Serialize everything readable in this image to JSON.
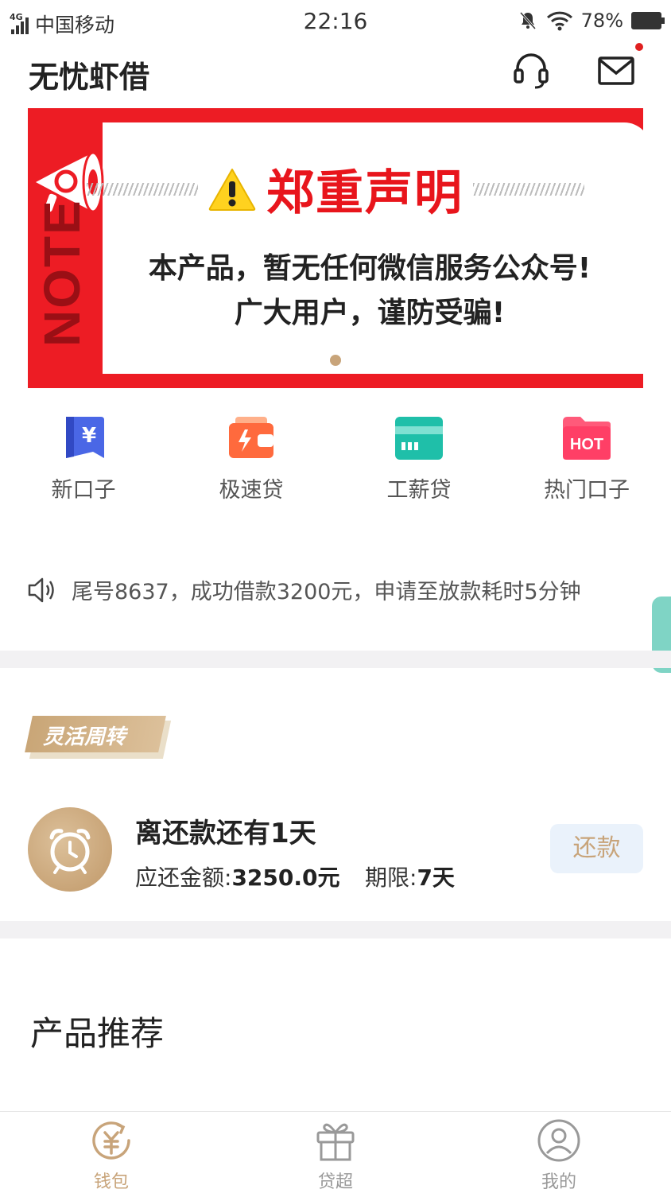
{
  "status_bar": {
    "network": "4G",
    "carrier": "中国移动",
    "time": "22:16",
    "battery": "78%"
  },
  "header": {
    "title": "无忧虾借",
    "support_icon": "headset-icon",
    "message_icon": "mail-icon"
  },
  "banner": {
    "side_label": "NOTE",
    "title": "郑重声明",
    "line1": "本产品，暂无任何微信服务公众号!",
    "line2": "广大用户，谨防受骗!",
    "colors": {
      "primary": "#ed1c24",
      "title": "#e8151c"
    }
  },
  "quick_nav": [
    {
      "label": "新口子",
      "icon": "bookmark-yuan-icon"
    },
    {
      "label": "极速贷",
      "icon": "wallet-bolt-icon"
    },
    {
      "label": "工薪贷",
      "icon": "card-icon"
    },
    {
      "label": "热门口子",
      "icon": "hot-folder-icon"
    }
  ],
  "notice": {
    "icon": "speaker-icon",
    "text": "尾号8637，成功借款3200元，申请至放款耗时5分钟"
  },
  "repayment": {
    "tag": "灵活周转",
    "title": "离还款还有1天",
    "amount_label": "应还金额:",
    "amount_value": "3250.0元",
    "term_label": "期限:",
    "term_value": "7天",
    "button": "还款",
    "accent": "#c8a47a"
  },
  "products": {
    "title": "产品推荐"
  },
  "bottom_nav": [
    {
      "label": "钱包",
      "icon": "wallet-yuan-icon",
      "active": true
    },
    {
      "label": "贷超",
      "icon": "gift-icon",
      "active": false
    },
    {
      "label": "我的",
      "icon": "user-icon",
      "active": false
    }
  ]
}
